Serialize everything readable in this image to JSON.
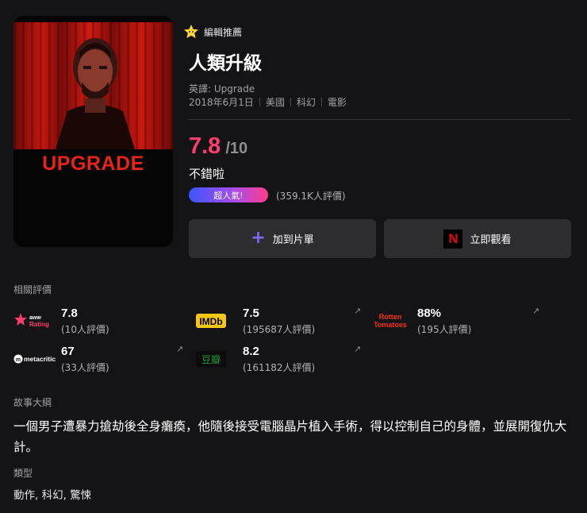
{
  "poster": {
    "title_text": "UPGRADE"
  },
  "editor_pick": {
    "label": "編輯推薦"
  },
  "movie": {
    "title": "人類升級",
    "english_title": "英譯: Upgrade",
    "meta": [
      "2018年6月1日",
      "美國",
      "科幻",
      "電影"
    ],
    "score": "7.8",
    "score_max": "/10",
    "verdict": "不錯啦",
    "badge": "超人氣!",
    "votes": "(359.1K人評價)"
  },
  "buttons": {
    "add_to_list": "加到片單",
    "watch_now": "立即觀看"
  },
  "ratings": {
    "section_label": "相關評價",
    "items": [
      {
        "source": "aww Rating",
        "logo_text": "aww Rating",
        "score": "7.8",
        "count": "(10人評價)"
      },
      {
        "source": "IMDb",
        "logo_text": "IMDb",
        "score": "7.5",
        "count": "(195687人評價)"
      },
      {
        "source": "Rotten Tomatoes",
        "logo_text": "Rotten Tomatoes",
        "score": "88%",
        "count": "(195人評價)"
      },
      {
        "source": "metacritic",
        "logo_text": "metacritic",
        "score": "67",
        "count": "(33人評價)"
      },
      {
        "source": "豆瓣",
        "logo_text": "豆瓣",
        "score": "8.2",
        "count": "(161182人評價)"
      }
    ]
  },
  "synopsis": {
    "label": "故事大綱",
    "text": "一個男子遭暴力搶劫後全身癱瘓，他隨後接受電腦晶片植入手術，得以控制自己的身體，並展開復仇大計。"
  },
  "genre": {
    "label": "類型",
    "text": "動作, 科幻, 驚悚"
  },
  "colors": {
    "background": "#141416",
    "score_accent": "#ff3d6e",
    "button_bg": "#2d2d31",
    "plus_icon": "#7f6bff",
    "netflix_red": "#e50914"
  }
}
